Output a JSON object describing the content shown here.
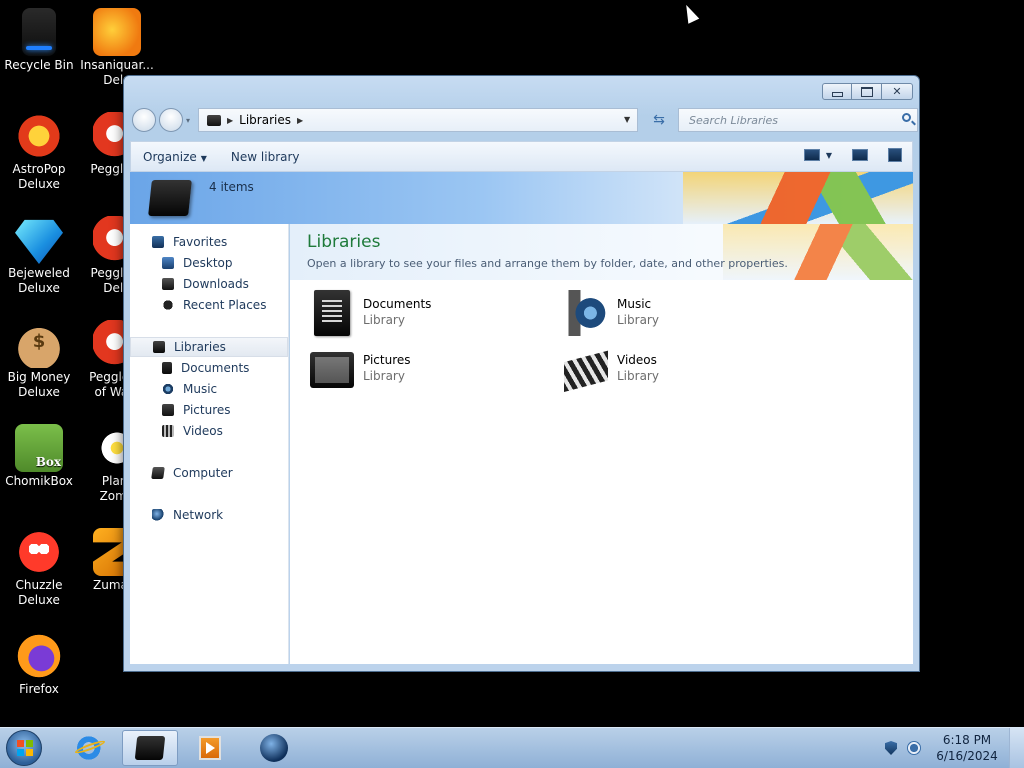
{
  "desktop": {
    "icons": [
      {
        "label": "Recycle Bin",
        "icon": "recycle-bin-icon"
      },
      {
        "label": "Insaniquar...\nDelu",
        "icon": "fish-icon"
      },
      {
        "label": "AstroPop\nDeluxe",
        "icon": "astropop-icon"
      },
      {
        "label": "Peggle D",
        "icon": "peggle-icon"
      },
      {
        "label": "Bejeweled\nDeluxe",
        "icon": "diamond-icon"
      },
      {
        "label": "Peggle N\nDelu",
        "icon": "peggle-icon"
      },
      {
        "label": "Big Money\nDeluxe",
        "icon": "money-bag-icon"
      },
      {
        "label": "Peggle W\nof Warc",
        "icon": "peggle-icon"
      },
      {
        "label": "ChomikBox",
        "icon": "chomikbox-icon"
      },
      {
        "label": "Plant\nZomb",
        "icon": "flower-icon"
      },
      {
        "label": "Chuzzle\nDeluxe",
        "icon": "chuzzle-icon"
      },
      {
        "label": "Zuma D",
        "icon": "zuma-icon"
      },
      {
        "label": "Firefox",
        "icon": "firefox-icon"
      }
    ]
  },
  "window": {
    "address": {
      "crumb": "Libraries"
    },
    "search": {
      "placeholder": "Search Libraries"
    },
    "toolbar": {
      "organize": "Organize",
      "new_library": "New library"
    },
    "banner": {
      "count": "4 items"
    },
    "nav": {
      "favorites": "Favorites",
      "desktop": "Desktop",
      "downloads": "Downloads",
      "recent": "Recent Places",
      "libraries": "Libraries",
      "documents": "Documents",
      "music": "Music",
      "pictures": "Pictures",
      "videos": "Videos",
      "computer": "Computer",
      "network": "Network"
    },
    "content": {
      "title": "Libraries",
      "subtitle": "Open a library to see your files and arrange them by folder, date, and other properties.",
      "items": [
        {
          "name": "Documents",
          "type": "Library"
        },
        {
          "name": "Music",
          "type": "Library"
        },
        {
          "name": "Pictures",
          "type": "Library"
        },
        {
          "name": "Videos",
          "type": "Library"
        }
      ]
    }
  },
  "taskbar": {
    "clock": {
      "time": "6:18 PM",
      "date": "6/16/2024"
    }
  }
}
